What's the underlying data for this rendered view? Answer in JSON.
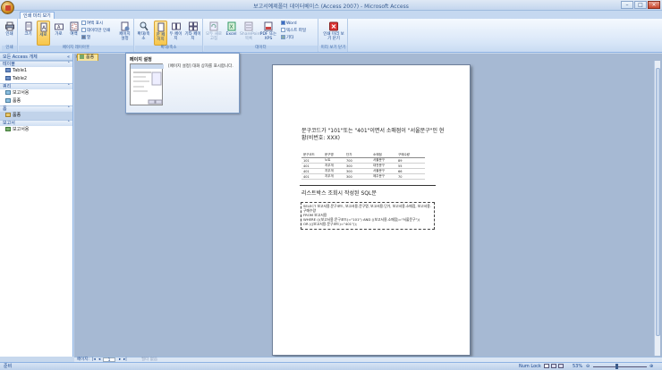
{
  "app": {
    "title": "보고서예제폴더 데이터베이스 (Access 2007) - Microsoft Access"
  },
  "tabs": [
    {
      "label": "인쇄 미리 보기"
    }
  ],
  "ribbon": {
    "groups": [
      {
        "label": "인쇄",
        "buttons": [
          {
            "label": "인쇄"
          }
        ]
      },
      {
        "label": "페이지 레이아웃",
        "buttons": [
          {
            "label": "크기"
          },
          {
            "label": "세로"
          },
          {
            "label": "가로"
          },
          {
            "label": "여백"
          },
          {
            "label": "페이지 설정"
          }
        ],
        "small": [
          "여백 표시",
          "데이터만 인쇄",
          "열"
        ]
      },
      {
        "label": "확대/축소",
        "buttons": [
          {
            "label": "확대/축소"
          },
          {
            "label": "한 페이지"
          },
          {
            "label": "두 페이지"
          },
          {
            "label": "기타 페이지"
          }
        ]
      },
      {
        "label": "데이터",
        "buttons": [
          {
            "label": "모두 새로 고침"
          },
          {
            "label": "Excel"
          },
          {
            "label": "SharePoint 목록"
          },
          {
            "label": "PDF 또는 XPS"
          }
        ],
        "small": [
          "Word",
          "텍스트 파일",
          "기타"
        ]
      },
      {
        "label": "미리 보기 닫기",
        "buttons": [
          {
            "label": "인쇄 미리 보기 닫기"
          }
        ]
      }
    ]
  },
  "nav": {
    "header": "모든 Access 개체",
    "groups": [
      {
        "label": "테이블",
        "items": [
          "Table1",
          "Table2"
        ]
      },
      {
        "label": "쿼리",
        "items": [
          "보고서용",
          "품종"
        ]
      },
      {
        "label": "폼",
        "items": [
          "품종"
        ]
      },
      {
        "label": "보고서",
        "items": [
          "보고서용"
        ]
      }
    ]
  },
  "doc": {
    "tab_label": "품종"
  },
  "tooltip": {
    "title": "페이지 설정",
    "body": "[페이지 설정] 대화 상자를 표시합니다."
  },
  "report": {
    "heading": "문구코드가 \"101\"또는 \"401\"이면서 소매점이 \"서울문구\"인 현황(비번호: XXX)",
    "columns": [
      "문구코드",
      "문구명",
      "단가",
      "소매점",
      "구매수량"
    ],
    "rows": [
      [
        "101",
        "노트",
        "700",
        "서울문구",
        "89"
      ],
      [
        "401",
        "지우개",
        "300",
        "대전문구",
        "55"
      ],
      [
        "401",
        "지우개",
        "300",
        "서울문구",
        "66"
      ],
      [
        "401",
        "지우개",
        "300",
        "제주문구",
        "70"
      ]
    ],
    "subheading": "리스트박스 조회시 작성된 SQL문",
    "sql": "SELECT 보고서용.문구코드, 보고서용.문구명, 보고서용.단가, 보고서용.소매점, 보고서용.구매수량\nFROM 보고서용\nWHERE (((보고서용.문구코드)=\"101\") AND ((보고서용.소매점)=\"서울문구\"))\nOR (((보고서용.문구코드)=\"401\"));"
  },
  "recnav": {
    "label": "페이지:",
    "page": "1",
    "filter": "필터 없음"
  },
  "status": {
    "left": "준비",
    "numlock": "Num Lock",
    "zoom": "53%"
  },
  "colors": {
    "ribbon_bg": "#dbe7f8",
    "highlight": "#f7c64a",
    "workspace": "#a6b9d3"
  }
}
